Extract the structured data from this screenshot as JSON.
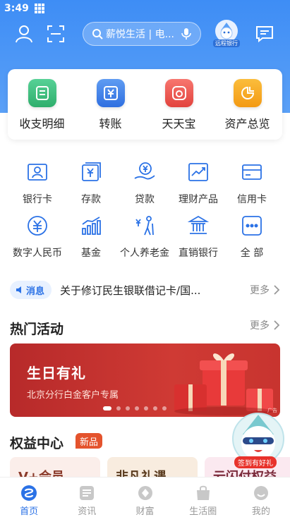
{
  "status_bar": {
    "time": "3:49"
  },
  "header": {
    "search_placeholder": "薪悦生活 | 电...",
    "avatar_label": "远程银行"
  },
  "quick_actions": [
    {
      "label": "收支明细",
      "icon": "statement-icon",
      "color": "#3dbb7b"
    },
    {
      "label": "转账",
      "icon": "transfer-icon",
      "color": "#3c7fe8"
    },
    {
      "label": "天天宝",
      "icon": "tiantianbao-icon",
      "color": "#ef5b55"
    },
    {
      "label": "资产总览",
      "icon": "pie-chart-icon",
      "color": "#f6a623"
    }
  ],
  "services": [
    {
      "label": "银行卡",
      "icon": "bank-card-icon"
    },
    {
      "label": "存款",
      "icon": "deposit-icon"
    },
    {
      "label": "贷款",
      "icon": "loan-icon"
    },
    {
      "label": "理财产品",
      "icon": "wealth-chart-icon"
    },
    {
      "label": "信用卡",
      "icon": "credit-card-icon"
    },
    {
      "label": "数字人民币",
      "icon": "digital-rmb-icon"
    },
    {
      "label": "基金",
      "icon": "fund-icon"
    },
    {
      "label": "个人养老金",
      "icon": "pension-icon"
    },
    {
      "label": "直销银行",
      "icon": "bank-building-icon"
    },
    {
      "label": "全 部",
      "icon": "more-dots-icon"
    }
  ],
  "notice": {
    "tag": "消息",
    "text": "关于修订民生银联借记卡/国...",
    "more": "更多"
  },
  "hot_activities": {
    "title": "热门活动",
    "more": "更多",
    "banner": {
      "title": "生日有礼",
      "subtitle": "北京分行白金客户专属",
      "ad_tag": "广告",
      "page_count": 7,
      "active_page": 0
    }
  },
  "rights_center": {
    "title": "权益中心",
    "badge": "新品",
    "cards": [
      {
        "label": "V+会员",
        "bg": "#fbeeea",
        "color": "#8a3a2a"
      },
      {
        "label": "非凡礼遇",
        "bg": "#f8ecdf",
        "color": "#5a3b1f"
      },
      {
        "label": "云闪付权益",
        "bg": "#fbe9f0",
        "color": "#7a2a3a"
      }
    ]
  },
  "floating_promo": {
    "label": "签到有好礼"
  },
  "tabbar": [
    {
      "label": "首页",
      "icon": "home-icon",
      "active": true
    },
    {
      "label": "资讯",
      "icon": "news-icon",
      "active": false
    },
    {
      "label": "财富",
      "icon": "wealth-icon",
      "active": false
    },
    {
      "label": "生活圈",
      "icon": "life-bag-icon",
      "active": false
    },
    {
      "label": "我的",
      "icon": "profile-icon",
      "active": false
    }
  ],
  "colors": {
    "brand_blue": "#3e8df5",
    "accent_blue": "#2b72e6",
    "banner_red": "#c8342f",
    "badge_orange": "#e4532d"
  }
}
